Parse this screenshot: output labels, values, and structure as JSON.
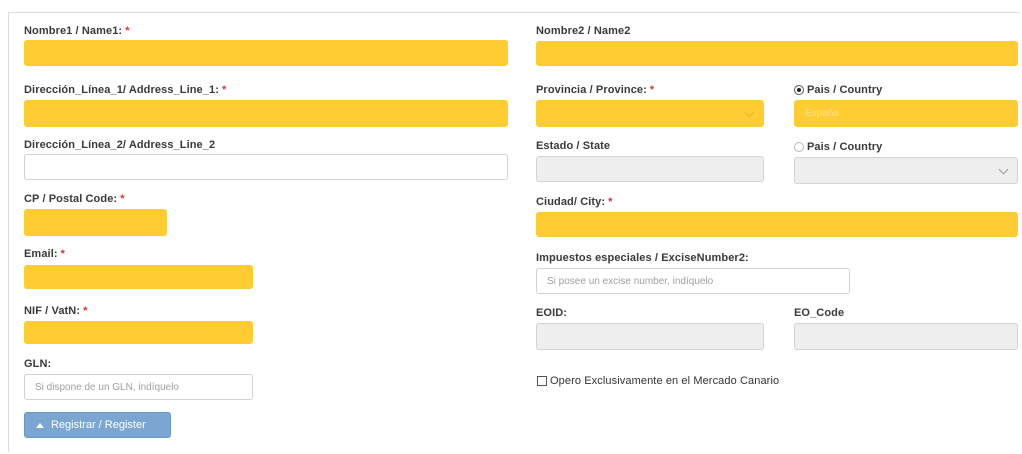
{
  "form": {
    "required_mark": "*",
    "name1": {
      "label": "Nombre1 / Name1:",
      "value": ""
    },
    "name2": {
      "label": "Nombre2 / Name2",
      "value": ""
    },
    "address1": {
      "label": "Dirección_Línea_1/ Address_Line_1:",
      "value": ""
    },
    "address2": {
      "label": "Dirección_Línea_2/ Address_Line_2",
      "value": ""
    },
    "province": {
      "label": "Provincia / Province:",
      "selected": ""
    },
    "country_radio_1": {
      "label": "Pais / Country",
      "checked": true,
      "value": "España"
    },
    "state": {
      "label": "Estado / State",
      "value": ""
    },
    "country_radio_2": {
      "label": "Pais / Country",
      "checked": false,
      "selected": ""
    },
    "postal_code": {
      "label": "CP / Postal Code:",
      "value": ""
    },
    "city": {
      "label": "Ciudad/ City:",
      "value": ""
    },
    "email": {
      "label": "Email:",
      "value": ""
    },
    "excise": {
      "label": "Impuestos especiales / ExciseNumber2:",
      "placeholder": "Si posee un excise number, indíquelo"
    },
    "nif": {
      "label": "NIF / VatN:",
      "value": ""
    },
    "eoid": {
      "label": "EOID:",
      "value": ""
    },
    "eo_code": {
      "label": "EO_Code",
      "value": ""
    },
    "gln": {
      "label": "GLN:",
      "placeholder": "Si dispone de un GLN, indíquelo"
    },
    "canary_checkbox": {
      "label": "Opero Exclusivamente en el Mercado Canario",
      "checked": false
    },
    "register_button": {
      "label": "Registrar / Register"
    }
  },
  "colors": {
    "required_highlight": "#ffcc33",
    "button": "#7aa6d1",
    "required_asterisk": "#e0302b",
    "disabled_field": "#eeeeee"
  },
  "icons": {
    "register_button": "chevron-up-icon",
    "select": "chevron-down-icon"
  }
}
